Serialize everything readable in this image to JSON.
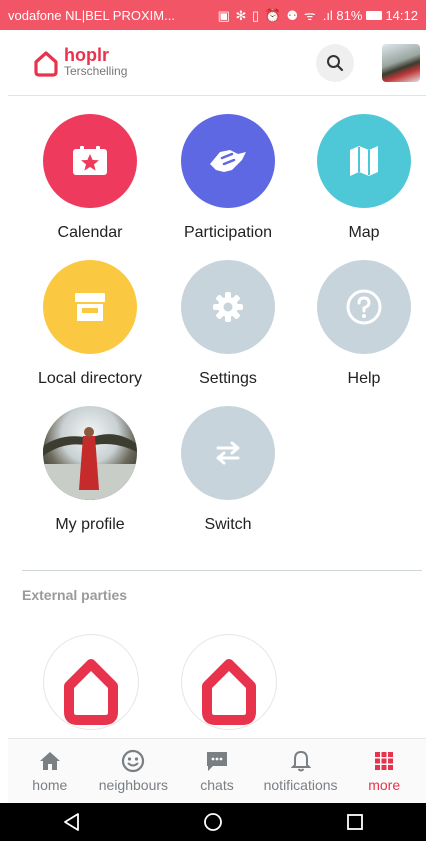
{
  "statusbar": {
    "carrier": "vodafone NL|BEL PROXIM...",
    "icons": "▣ ✻ ▯ ⏰ ⚉ ᯤ",
    "battery": ".ıl 81%",
    "time": "14:12"
  },
  "header": {
    "brand": "hoplr",
    "community": "Terschelling"
  },
  "menu": [
    {
      "label": "Calendar",
      "color": "#ee3b5d",
      "icon": "calendar-star-icon"
    },
    {
      "label": "Participation",
      "color": "#5d68e2",
      "icon": "handshake-icon"
    },
    {
      "label": "Map",
      "color": "#4ec7d6",
      "icon": "map-icon"
    },
    {
      "label": "Local directory",
      "color": "#fbc941",
      "icon": "shop-icon"
    },
    {
      "label": "Settings",
      "color": "#c7d4db",
      "icon": "gear-icon"
    },
    {
      "label": "Help",
      "color": "#c7d4db",
      "icon": "help-icon"
    },
    {
      "label": "My profile",
      "color": "#c7d4db",
      "icon": "avatar"
    },
    {
      "label": "Switch",
      "color": "#c7d4db",
      "icon": "swap-icon"
    }
  ],
  "external": {
    "title": "External parties"
  },
  "bottom_nav": [
    {
      "label": "home",
      "active": false
    },
    {
      "label": "neighbours",
      "active": false
    },
    {
      "label": "chats",
      "active": false
    },
    {
      "label": "notifications",
      "active": false
    },
    {
      "label": "more",
      "active": true
    }
  ],
  "colors": {
    "accent": "#e8334d",
    "statusbar": "#f25565",
    "inactive": "#7a7f84"
  }
}
